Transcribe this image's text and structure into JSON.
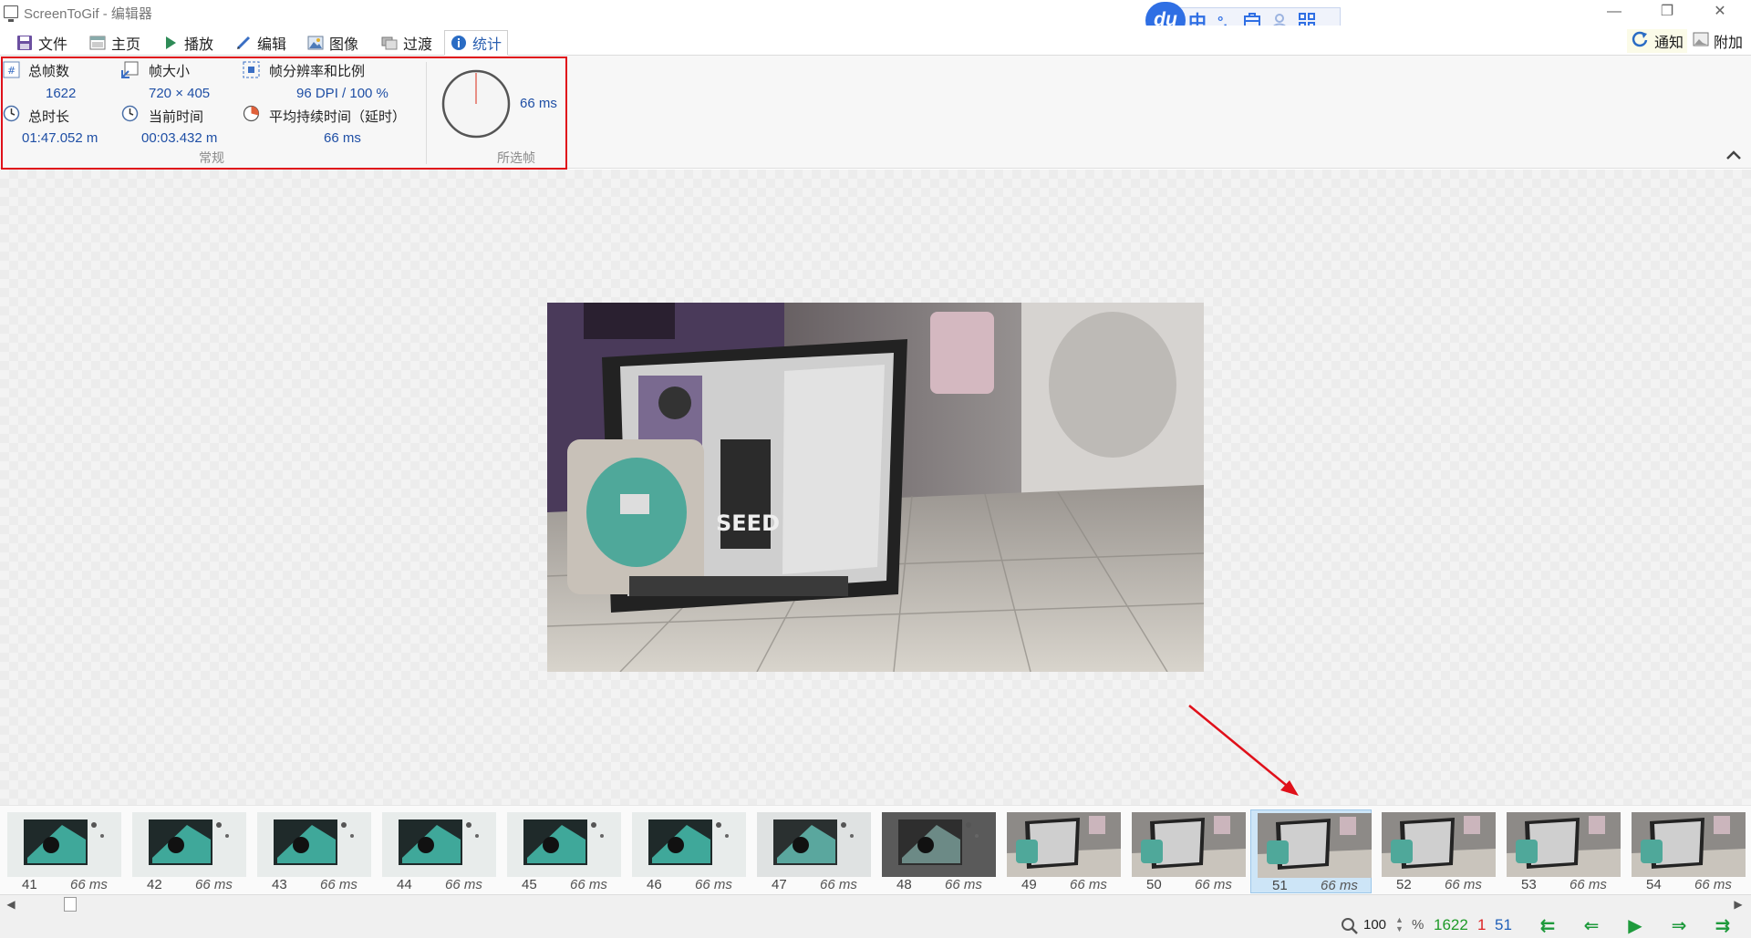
{
  "window": {
    "title": "ScreenToGif - 编辑器",
    "controls": {
      "minimize": "—",
      "maximize": "❐",
      "close": "✕"
    }
  },
  "ime": {
    "logo": "du",
    "mode": "中",
    "punct": "°,",
    "icons": [
      "toolbox-icon",
      "user-icon",
      "grid-icon"
    ]
  },
  "menu": {
    "tabs": [
      {
        "label": "文件",
        "icon": "save-icon"
      },
      {
        "label": "主页",
        "icon": "home-icon"
      },
      {
        "label": "播放",
        "icon": "play-icon"
      },
      {
        "label": "编辑",
        "icon": "pencil-icon"
      },
      {
        "label": "图像",
        "icon": "image-icon"
      },
      {
        "label": "过渡",
        "icon": "transition-icon"
      },
      {
        "label": "统计",
        "icon": "info-icon",
        "active": true
      }
    ],
    "notify_label": "通知",
    "attach_label": "附加"
  },
  "stats": {
    "total_frames_label": "总帧数",
    "total_frames_value": "1622",
    "frame_size_label": "帧大小",
    "frame_size_value": "720 × 405",
    "resolution_label": "帧分辨率和比例",
    "resolution_value": "96 DPI / 100 %",
    "total_duration_label": "总时长",
    "total_duration_value": "01:47.052 m",
    "current_time_label": "当前时间",
    "current_time_value": "00:03.432 m",
    "avg_duration_label": "平均持续时间（延时）",
    "avg_duration_value": "66 ms",
    "general_section": "常规",
    "selected_value": "66 ms",
    "selected_section": "所选帧"
  },
  "filmstrip": {
    "frames": [
      {
        "number": "41",
        "duration": "66 ms",
        "tone": "teal"
      },
      {
        "number": "42",
        "duration": "66 ms",
        "tone": "teal"
      },
      {
        "number": "43",
        "duration": "66 ms",
        "tone": "teal"
      },
      {
        "number": "44",
        "duration": "66 ms",
        "tone": "teal"
      },
      {
        "number": "45",
        "duration": "66 ms",
        "tone": "teal"
      },
      {
        "number": "46",
        "duration": "66 ms",
        "tone": "teal"
      },
      {
        "number": "47",
        "duration": "66 ms",
        "tone": "teal-gray"
      },
      {
        "number": "48",
        "duration": "66 ms",
        "tone": "dark"
      },
      {
        "number": "49",
        "duration": "66 ms",
        "tone": "room"
      },
      {
        "number": "50",
        "duration": "66 ms",
        "tone": "room"
      },
      {
        "number": "51",
        "duration": "66 ms",
        "tone": "room",
        "selected": true
      },
      {
        "number": "52",
        "duration": "66 ms",
        "tone": "room"
      },
      {
        "number": "53",
        "duration": "66 ms",
        "tone": "room"
      },
      {
        "number": "54",
        "duration": "66 ms",
        "tone": "room"
      }
    ]
  },
  "statusbar": {
    "zoom": "100",
    "percent": "%",
    "total": "1622",
    "selected": "1",
    "current": "51"
  },
  "colors": {
    "accent": "#1f4fa5",
    "highlight_border": "#e0101a",
    "nav_green": "#1e9a3c"
  }
}
